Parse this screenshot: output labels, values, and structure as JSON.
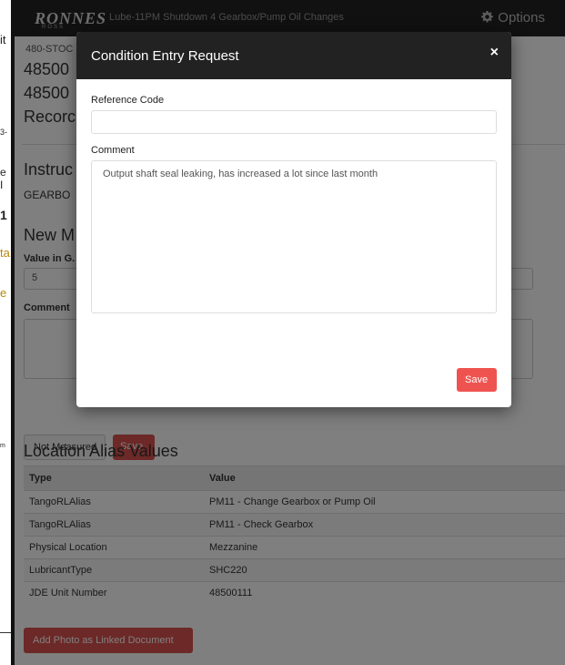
{
  "outer_fragments": [
    "it",
    "3-",
    "e I",
    "1",
    "ta",
    "e",
    "m"
  ],
  "navbar": {
    "logo": "RONNES",
    "logo_sub": "ROSS",
    "title": "Lube-11PM Shutdown 4 Gearbox/Pump Oil Changes",
    "options_label": "Options",
    "options_icon": "gear-icon"
  },
  "page": {
    "code_small": "480-STOC",
    "line1": "48500",
    "line2": "48500",
    "line3": "Recorc",
    "instructions_heading": "Instruc",
    "instructions_text": "GEARBO",
    "new_heading": "New M",
    "value_label": "Value in G.",
    "value": "5",
    "comment_label": "Comment",
    "not_measured_label": "Not Measured",
    "save_label": "Save"
  },
  "aliases": {
    "heading": "Location Alias Values",
    "columns": [
      "Type",
      "Value"
    ],
    "rows": [
      [
        "TangoRLAlias",
        "PM11 - Change Gearbox or Pump Oil"
      ],
      [
        "TangoRLAlias",
        "PM11 - Check Gearbox"
      ],
      [
        "Physical Location",
        "Mezzanine"
      ],
      [
        "LubricantType",
        "SHC220"
      ],
      [
        "JDE Unit Number",
        "48500111"
      ]
    ],
    "add_photo_label": "Add Photo as Linked Document"
  },
  "modal": {
    "title": "Condition Entry Request",
    "close_symbol": "×",
    "reference_label": "Reference Code",
    "reference_value": "",
    "comment_label": "Comment",
    "comment_value": "Output shaft seal leaking, has increased a lot since last month",
    "save_label": "Save"
  },
  "colors": {
    "navbar": "#222222",
    "danger": "#d9534f",
    "modal_save": "#ef5350"
  }
}
